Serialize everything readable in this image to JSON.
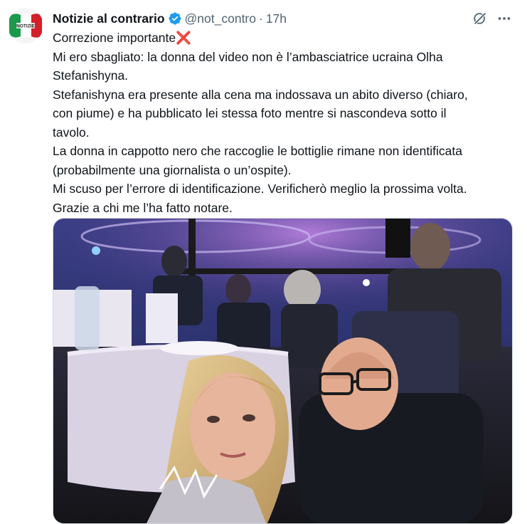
{
  "author": {
    "name": "Notizie al contrario",
    "handle": "@not_contro",
    "separator": "·",
    "time": "17h",
    "verified": true,
    "verified_color": "#1d9bf0",
    "avatar_icon": "italian-flag-avatar-icon",
    "avatar_text": "NOTIZIE"
  },
  "actions": {
    "grok_icon": "grok-icon",
    "more_icon": "more-horizontal-icon"
  },
  "tweet": {
    "lines": [
      "Correzione importante",
      "Mi ero sbagliato: la donna del video non è l’ambasciatrice ucraina Olha",
      "Stefanishyna.",
      "Stefanishyna era presente alla cena ma indossava un abito diverso (chiaro,",
      "con piume) e ha pubblicato lei stessa foto mentre si nascondeva sotto il",
      "tavolo.",
      "La donna in cappotto nero che raccoglie le bottiglie rimane non identificata",
      "(probabilmente una giornalista o un’ospite).",
      "Mi scuso per l’errore di identificazione. Verificherò meglio la prossima volta.",
      "Grazie a chi me l’ha fatto notare."
    ],
    "emoji": "❌"
  },
  "media": {
    "type": "photo",
    "icon": "photo-image"
  },
  "colors": {
    "text_primary": "#0f1419",
    "text_secondary": "#536471",
    "accent": "#1d9bf0",
    "border": "#cfd9de"
  }
}
